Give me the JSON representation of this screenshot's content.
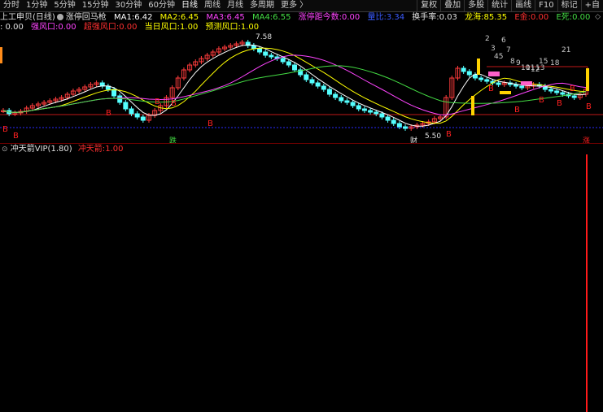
{
  "toolbar": {
    "left_items": [
      "分时",
      "1分钟",
      "5分钟",
      "15分钟",
      "30分钟",
      "60分钟",
      "日线",
      "周线",
      "月线",
      "多周期",
      "更多 〉"
    ],
    "active": "日线",
    "right_items": [
      "复权",
      "叠加",
      "多股",
      "统计",
      "画线",
      "F10",
      "标记",
      "+自"
    ]
  },
  "header": {
    "stock": "上工申贝(日线)",
    "indicator": "涨停回马枪",
    "ma1_label": "MA1:",
    "ma1": "6.42",
    "ma2_label": "MA2:",
    "ma2": "6.45",
    "ma3_label": "MA3:",
    "ma3": "6.45",
    "ma4_label": "MA4:",
    "ma4": "6.55",
    "zt_label": "涨停距今数:",
    "zt": "0.00",
    "lb_label": "量比:",
    "lb": "3.34",
    "hs_label": "换手率:",
    "hs": "0.03",
    "lh_label": "龙海:",
    "lh": "85.35",
    "ej_label": "E金:",
    "ej": "0.00",
    "es_label": "E死:",
    "es": "0.00"
  },
  "header2": {
    "lead": ": 0.00",
    "qf_label": "强风口:",
    "qf": "0.00",
    "cqf_label": "超强风口:",
    "cqf": "0.00",
    "dr_label": "当日风口:",
    "dr": "1.00",
    "yc_label": "预测风口:",
    "yc": "1.00"
  },
  "chart": {
    "high_label": "7.58",
    "low_label": "5.50",
    "b_marker": "B",
    "die_label": "跌",
    "cai_label": "财",
    "zhang_label": "涨",
    "numbers": [
      "2",
      "3",
      "45",
      "6",
      "7",
      "8",
      "9",
      "10",
      "11",
      "12",
      "13",
      "15",
      "18",
      "21"
    ]
  },
  "sub": {
    "title": "冲天箭VIP(1.80)",
    "value_label": "冲天箭:",
    "value": "1.00"
  },
  "colors": {
    "up": "#ff3c3c",
    "down": "#54ffff",
    "ma1": "#ffffff",
    "ma2": "#ffff00",
    "ma3": "#ff44ff",
    "ma4": "#44dd44",
    "marker": "#ff2020"
  }
}
